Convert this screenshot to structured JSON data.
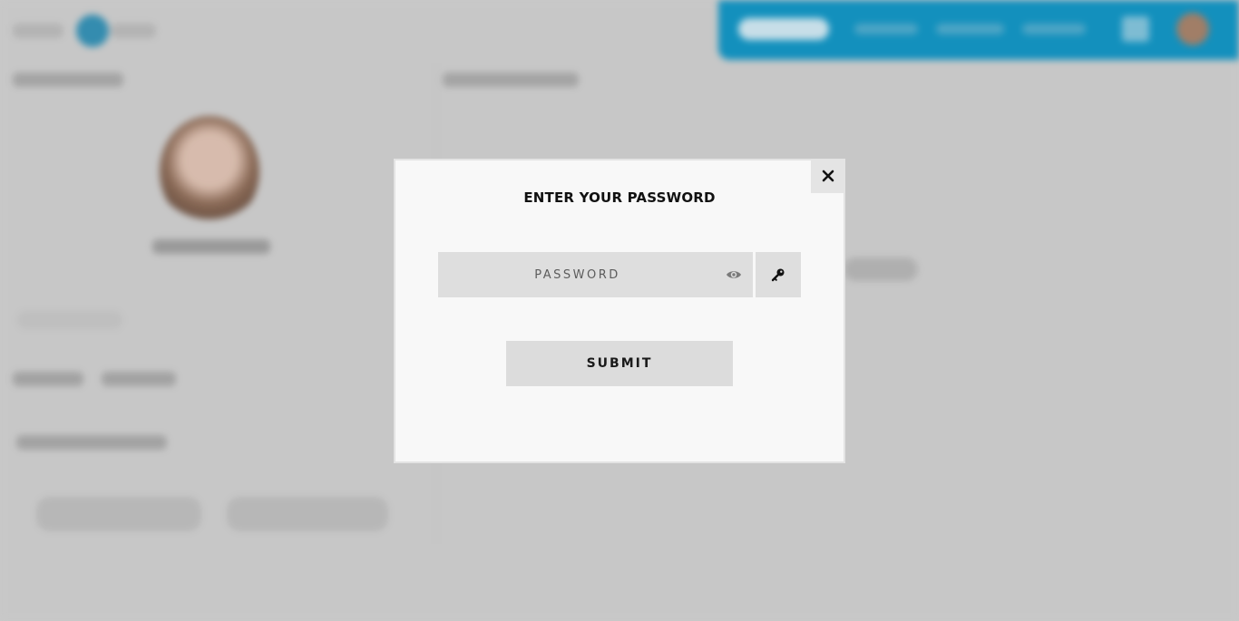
{
  "modal": {
    "title": "ENTER YOUR PASSWORD",
    "password_placeholder": "PASSWORD",
    "password_value": "",
    "submit_label": "SUBMIT",
    "close_icon": "close-icon",
    "visibility_icon": "eye-icon",
    "key_icon": "key-icon"
  },
  "colors": {
    "modal_background": "#f8f8f8",
    "input_background": "#dedede",
    "backdrop": "#d2d2d2",
    "topbar_accent": "#0b93c4",
    "text": "#111111"
  }
}
